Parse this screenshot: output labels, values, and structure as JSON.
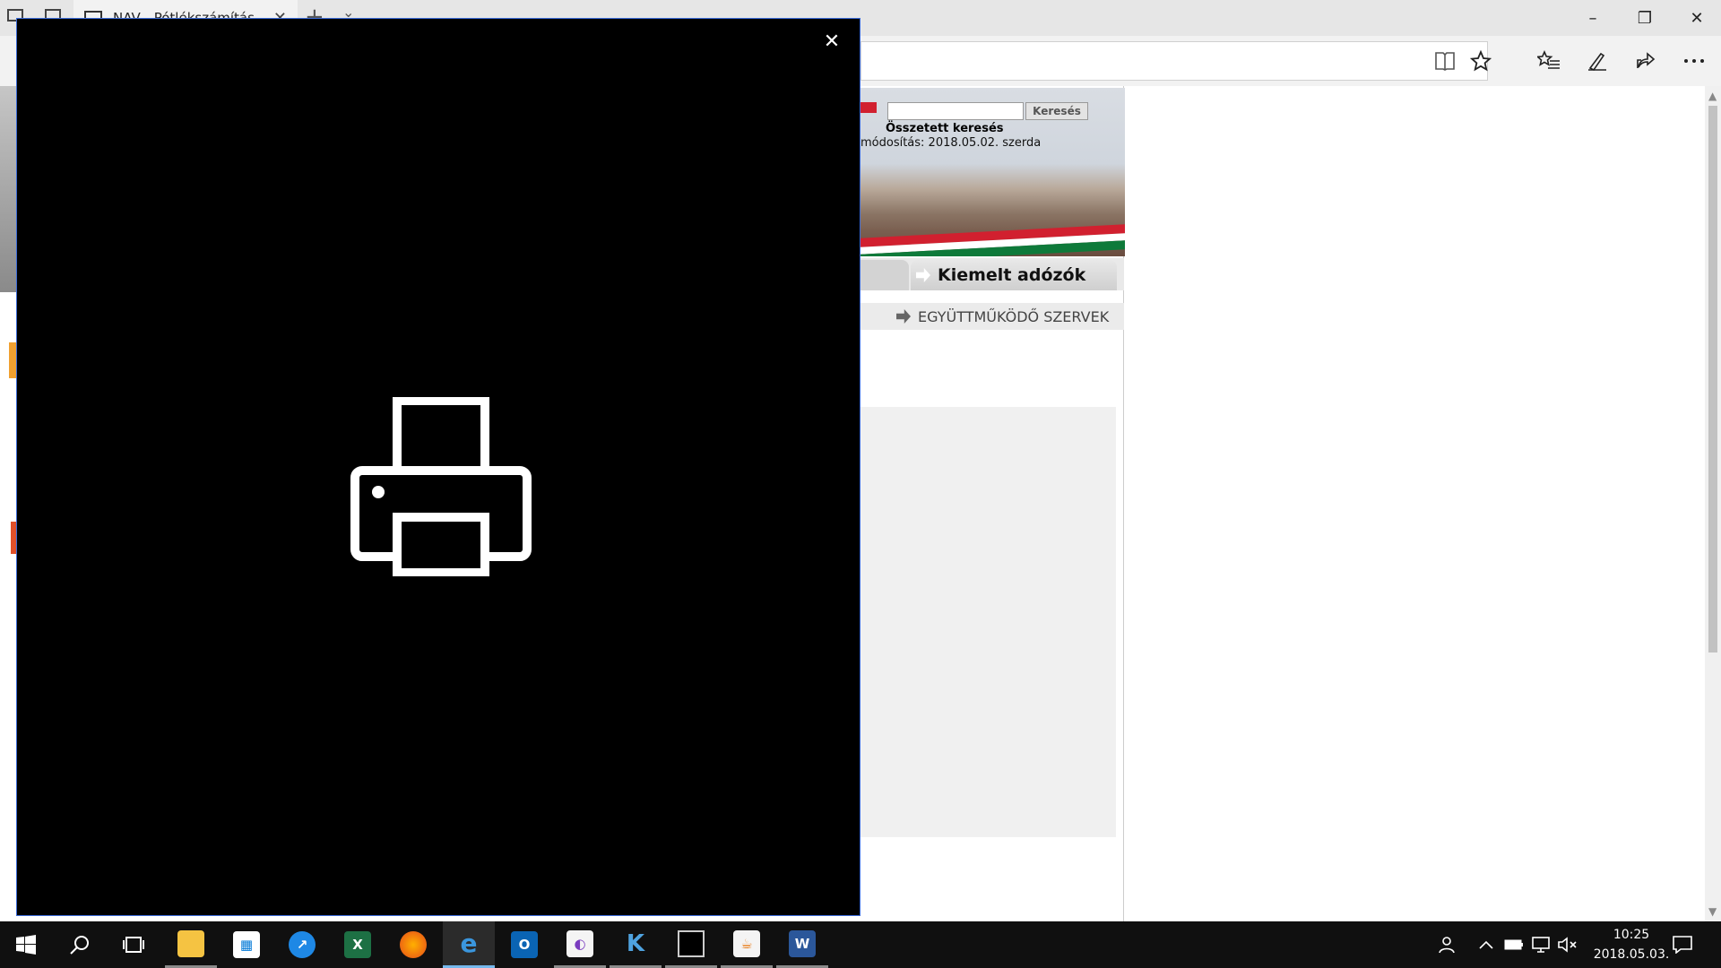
{
  "browser": {
    "tab_title": "NAV - Pótlékszámítás",
    "new_tab_glyph": "+",
    "tab_menu_glyph": "⌄",
    "close_tab_glyph": "✕",
    "window_controls": {
      "minimize": "–",
      "restore": "❐",
      "close": "✕"
    },
    "toolbar_icons": [
      "reading-view-icon",
      "favorite-star-icon",
      "favorites-hub-icon",
      "pen-icon",
      "share-icon",
      "more-icon"
    ]
  },
  "page": {
    "search_button": "Keresés",
    "advanced_search": "Összetett keresés",
    "last_modified": "módosítás: 2018.05.02.  szerda",
    "tab_featured": "Kiemelt adózók",
    "partners_link": "EGYÜTTMŰKÖDŐ SZERVEK"
  },
  "print_dialog": {
    "close_glyph": "✕",
    "icon": "printer-icon"
  },
  "taskbar": {
    "apps": [
      "start",
      "search",
      "task-view",
      "file-explorer",
      "store",
      "safari",
      "excel",
      "firefox",
      "edge",
      "outlook",
      "app-generic",
      "app-k",
      "terminal",
      "java",
      "word"
    ],
    "labels": {
      "excel": "X",
      "outlook": "O",
      "word": "W"
    },
    "clock_time": "10:25",
    "clock_date": "2018.05.03."
  },
  "colors": {
    "accent": "#76b9ed",
    "dialog_border": "#3a6ad8",
    "taskbar": "#101010"
  }
}
